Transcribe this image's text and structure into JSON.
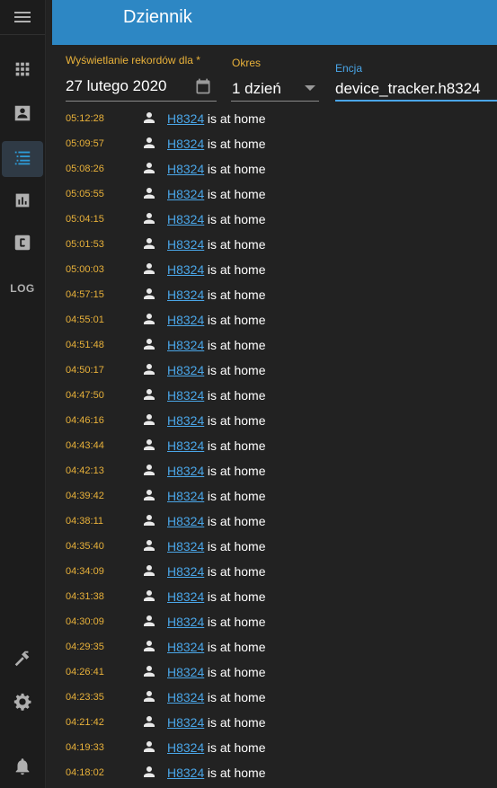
{
  "header": {
    "title": "Dziennik"
  },
  "sidebar": {
    "menu_icon": "hamburger-menu-icon",
    "items": [
      {
        "name": "overview",
        "icon": "grid-icon"
      },
      {
        "name": "map",
        "icon": "account-box-icon"
      },
      {
        "name": "logbook",
        "icon": "list-icon",
        "active": true
      },
      {
        "name": "history",
        "icon": "chart-bar-icon"
      },
      {
        "name": "hacs",
        "icon": "c-box-icon"
      },
      {
        "name": "log",
        "label": "LOG"
      },
      {
        "name": "developer-tools",
        "icon": "hammer-icon"
      },
      {
        "name": "settings",
        "icon": "gear-icon"
      },
      {
        "name": "notifications",
        "icon": "bell-icon"
      }
    ]
  },
  "filters": {
    "date_label": "Wyświetlanie rekordów dla *",
    "date_value": "27 lutego 2020",
    "period_label": "Okres",
    "period_value": "1 dzień",
    "entity_label": "Encja",
    "entity_value": "device_tracker.h8324"
  },
  "entries": [
    {
      "time": "05:12:28",
      "entity": "H8324",
      "message": " is at home"
    },
    {
      "time": "05:09:57",
      "entity": "H8324",
      "message": " is at home"
    },
    {
      "time": "05:08:26",
      "entity": "H8324",
      "message": " is at home"
    },
    {
      "time": "05:05:55",
      "entity": "H8324",
      "message": " is at home"
    },
    {
      "time": "05:04:15",
      "entity": "H8324",
      "message": " is at home"
    },
    {
      "time": "05:01:53",
      "entity": "H8324",
      "message": " is at home"
    },
    {
      "time": "05:00:03",
      "entity": "H8324",
      "message": " is at home"
    },
    {
      "time": "04:57:15",
      "entity": "H8324",
      "message": " is at home"
    },
    {
      "time": "04:55:01",
      "entity": "H8324",
      "message": " is at home"
    },
    {
      "time": "04:51:48",
      "entity": "H8324",
      "message": " is at home"
    },
    {
      "time": "04:50:17",
      "entity": "H8324",
      "message": " is at home"
    },
    {
      "time": "04:47:50",
      "entity": "H8324",
      "message": " is at home"
    },
    {
      "time": "04:46:16",
      "entity": "H8324",
      "message": " is at home"
    },
    {
      "time": "04:43:44",
      "entity": "H8324",
      "message": " is at home"
    },
    {
      "time": "04:42:13",
      "entity": "H8324",
      "message": " is at home"
    },
    {
      "time": "04:39:42",
      "entity": "H8324",
      "message": " is at home"
    },
    {
      "time": "04:38:11",
      "entity": "H8324",
      "message": " is at home"
    },
    {
      "time": "04:35:40",
      "entity": "H8324",
      "message": " is at home"
    },
    {
      "time": "04:34:09",
      "entity": "H8324",
      "message": " is at home"
    },
    {
      "time": "04:31:38",
      "entity": "H8324",
      "message": " is at home"
    },
    {
      "time": "04:30:09",
      "entity": "H8324",
      "message": " is at home"
    },
    {
      "time": "04:29:35",
      "entity": "H8324",
      "message": " is at home"
    },
    {
      "time": "04:26:41",
      "entity": "H8324",
      "message": " is at home"
    },
    {
      "time": "04:23:35",
      "entity": "H8324",
      "message": " is at home"
    },
    {
      "time": "04:21:42",
      "entity": "H8324",
      "message": " is at home"
    },
    {
      "time": "04:19:33",
      "entity": "H8324",
      "message": " is at home"
    },
    {
      "time": "04:18:02",
      "entity": "H8324",
      "message": " is at home"
    }
  ],
  "colors": {
    "header": "#2d87c4",
    "background": "#222222",
    "sidebar": "#1c1c1c",
    "time": "#e8b13a",
    "link": "#4aa6e8",
    "active": "#2e9bd6"
  }
}
